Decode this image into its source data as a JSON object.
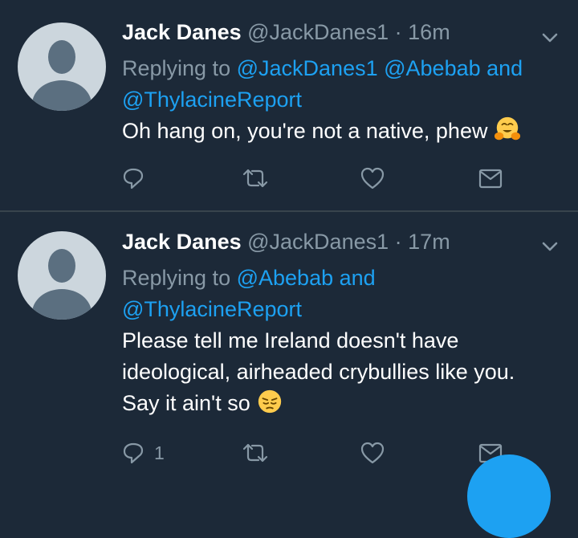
{
  "tweets": [
    {
      "name": "Jack Danes",
      "handle": "@JackDanes1",
      "separator": "·",
      "time": "16m",
      "replying_label": "Replying to",
      "mentions": [
        "@JackDanes1",
        "@Abebab"
      ],
      "and_label": "and",
      "mention_last": "@ThylacineReport",
      "body": "Oh hang on, you're not a native, phew",
      "emoji": "hugging-face-emoji",
      "reply_count": ""
    },
    {
      "name": "Jack Danes",
      "handle": "@JackDanes1",
      "separator": "·",
      "time": "17m",
      "replying_label": "Replying to",
      "mentions": [
        "@Abebab"
      ],
      "and_label": "and",
      "mention_last": "@ThylacineReport",
      "body_lines": [
        "Please tell me Ireland doesn't have",
        "ideological, airheaded crybullies like you.",
        "Say it ain't so"
      ],
      "emoji": "pensive-face-emoji",
      "reply_count": "1"
    }
  ],
  "icons": {
    "reply": "reply-icon",
    "retweet": "retweet-icon",
    "like": "heart-icon",
    "dm": "envelope-icon",
    "caret": "chevron-down-icon"
  },
  "colors": {
    "background": "#1c2938",
    "accent": "#1da1f2",
    "secondary_text": "#8899a6",
    "divider": "#38444d"
  }
}
